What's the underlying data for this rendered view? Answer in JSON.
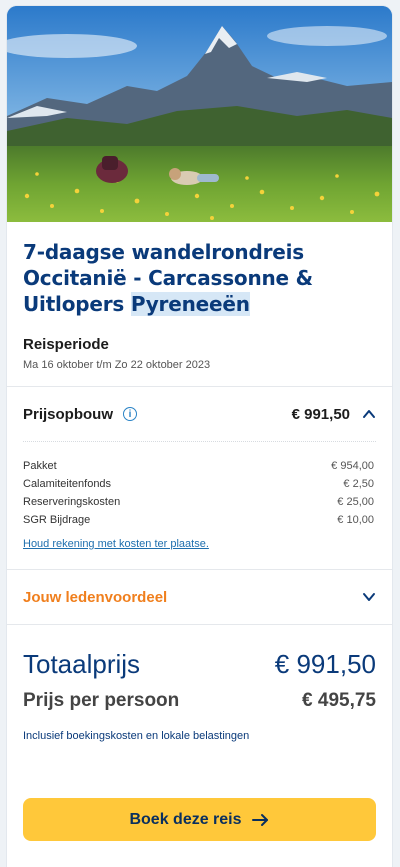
{
  "trip": {
    "title_main": "7-daagse wandelrondreis Occitanië - Carcassonne & Uitlopers",
    "title_highlight": "Pyreneeën"
  },
  "period": {
    "label": "Reisperiode",
    "value": "Ma 16 oktober t/m Zo 22 oktober 2023"
  },
  "price_breakdown": {
    "title": "Prijsopbouw",
    "info_icon": "info-icon",
    "total": "€ 991,50",
    "expanded": true,
    "items": [
      {
        "label": "Pakket",
        "value": "€ 954,00"
      },
      {
        "label": "Calamiteitenfonds",
        "value": "€ 2,50"
      },
      {
        "label": "Reserveringskosten",
        "value": "€ 25,00"
      },
      {
        "label": "SGR Bijdrage",
        "value": "€ 10,00"
      }
    ],
    "link": "Houd rekening met kosten ter plaatse."
  },
  "member_benefit": {
    "title": "Jouw ledenvoordeel",
    "expanded": false
  },
  "totals": {
    "total_label": "Totaalprijs",
    "total_value": "€ 991,50",
    "per_person_label": "Prijs per persoon",
    "per_person_value": "€ 495,75",
    "note": "Inclusief boekingskosten en lokale belastingen"
  },
  "cta": {
    "label": "Boek deze reis",
    "icon": "arrow-right-icon"
  },
  "colors": {
    "primary": "#0a3a7a",
    "accent_orange": "#f07f1d",
    "cta_yellow": "#ffc83a",
    "link": "#1f6fae"
  }
}
